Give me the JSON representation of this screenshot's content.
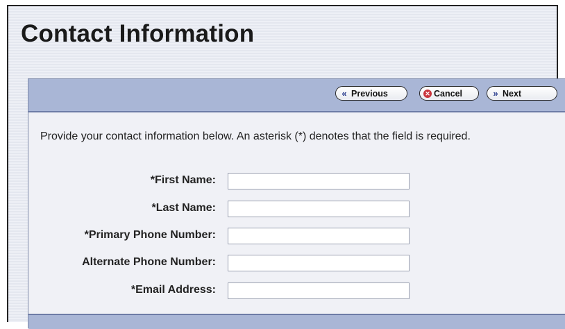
{
  "page": {
    "title": "Contact Information",
    "intro": "Provide your contact information below. An asterisk (*) denotes that the field is required."
  },
  "toolbar": {
    "previous_label": "Previous",
    "cancel_label": "Cancel",
    "next_label": "Next"
  },
  "form": {
    "fields": [
      {
        "label": "*First Name:",
        "value": ""
      },
      {
        "label": "*Last Name:",
        "value": ""
      },
      {
        "label": "*Primary Phone Number:",
        "value": ""
      },
      {
        "label": "Alternate Phone Number:",
        "value": ""
      },
      {
        "label": "*Email Address:",
        "value": ""
      }
    ]
  },
  "colors": {
    "toolbar_bg": "#a9b6d6",
    "panel_bg": "#f0f1f6",
    "cancel_icon": "#c9343c",
    "arrow_icon": "#2c3f8f"
  },
  "icons": {
    "previous": "double-chevron-left-icon",
    "cancel": "cancel-x-icon",
    "next": "double-chevron-right-icon"
  }
}
